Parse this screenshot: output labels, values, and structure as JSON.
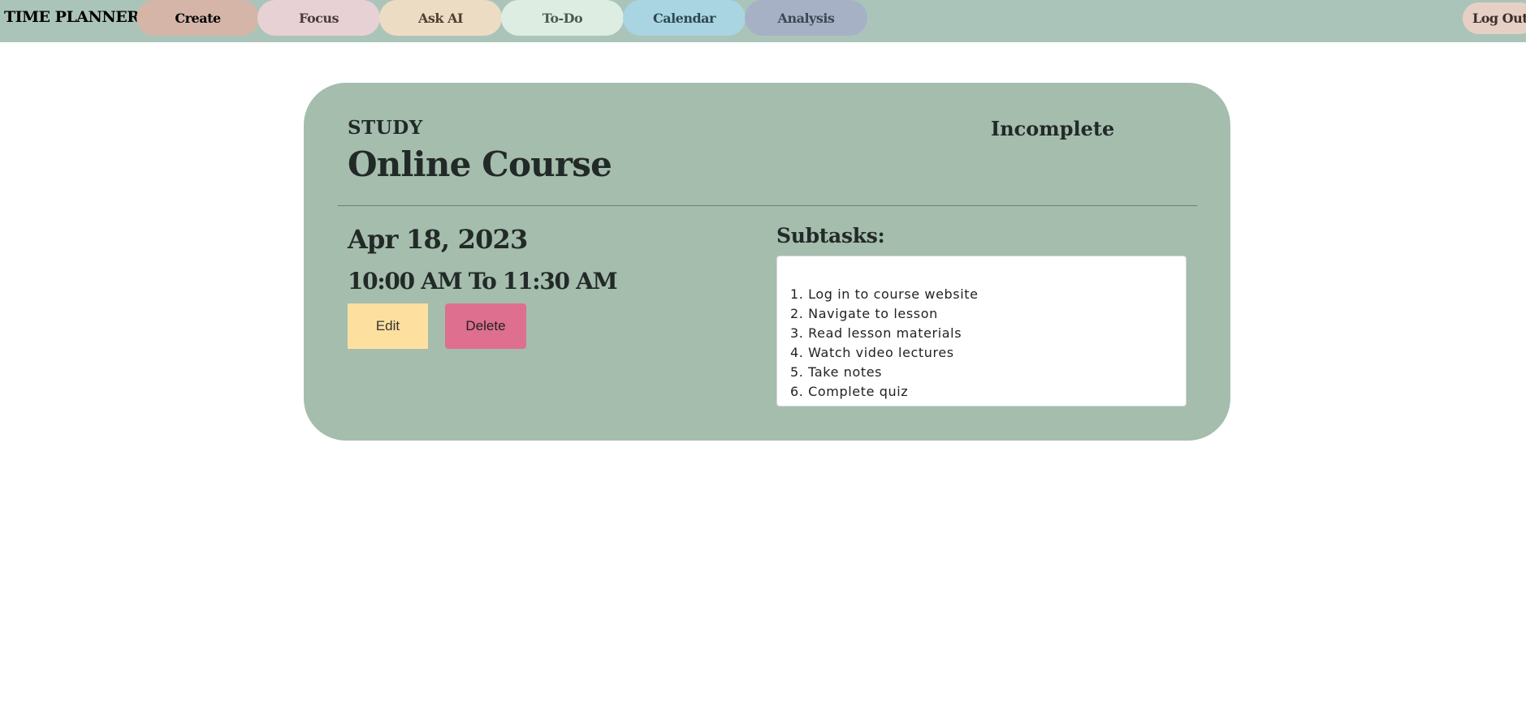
{
  "navbar": {
    "brand": "TIME PLANNER",
    "tabs": [
      {
        "label": "Create",
        "bg": "#d4b5a8",
        "color": "#000000"
      },
      {
        "label": "Focus",
        "bg": "#e7d1d5",
        "color": "#4a3a3e"
      },
      {
        "label": "Ask AI",
        "bg": "#eddcc4",
        "color": "#4d4030"
      },
      {
        "label": "To-Do",
        "bg": "#ddede2",
        "color": "#4a5a50"
      },
      {
        "label": "Calendar",
        "bg": "#a9d5e2",
        "color": "#304850"
      },
      {
        "label": "Analysis",
        "bg": "#a7b1c5",
        "color": "#3e4656"
      }
    ],
    "logout": {
      "label": "Log Out",
      "bg": "#e6d0c5",
      "color": "#3b2e2a"
    }
  },
  "task": {
    "category": "STUDY",
    "title": "Online Course",
    "status": "Incomplete",
    "date": "Apr 18, 2023",
    "time": "10:00 AM To 11:30 AM",
    "edit_label": "Edit",
    "delete_label": "Delete",
    "subtasks_label": "Subtasks:",
    "subtasks": [
      "1. Log in to course website",
      "2. Navigate to lesson",
      "3. Read lesson materials",
      "4. Watch video lectures",
      "5. Take notes",
      "6. Complete quiz"
    ]
  },
  "colors": {
    "navbar_bg": "#abc4ba",
    "card_bg": "#a5bdad",
    "edit_bg": "#fde0a0",
    "delete_bg": "#de6f8f"
  }
}
